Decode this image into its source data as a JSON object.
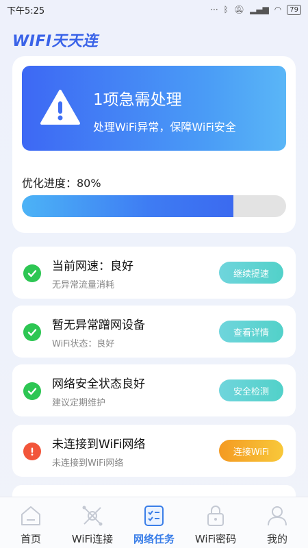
{
  "status_bar": {
    "time": "下午5:25",
    "battery": "79"
  },
  "app": {
    "title": "WIFI天天连"
  },
  "alert": {
    "title": "1项急需处理",
    "subtitle": "处理WiFi异常，保障WiFi安全",
    "progress_label": "优化进度：80%",
    "progress": 0.8
  },
  "tasks": [
    {
      "title": "当前网速：良好",
      "subtitle": "无异常流量消耗",
      "button": "继续提速",
      "status": "ok"
    },
    {
      "title": "暂无异常蹭网设备",
      "subtitle": "WiFi状态：良好",
      "button": "查看详情",
      "status": "ok"
    },
    {
      "title": "网络安全状态良好",
      "subtitle": "建议定期维护",
      "button": "安全检测",
      "status": "ok"
    },
    {
      "title": "未连接到WiFi网络",
      "subtitle": "未连接到WiFi网络",
      "button": "连接WiFi",
      "status": "error"
    }
  ],
  "nav": [
    {
      "label": "首页",
      "icon": "home-icon"
    },
    {
      "label": "WiFi连接",
      "icon": "wifi-connect-icon"
    },
    {
      "label": "网络任务",
      "icon": "task-list-icon",
      "active": true
    },
    {
      "label": "WiFi密码",
      "icon": "lock-icon"
    },
    {
      "label": "我的",
      "icon": "user-icon"
    }
  ],
  "colors": {
    "accent": "#3a7ee8",
    "ok": "#2dc653",
    "error": "#f2553a"
  }
}
